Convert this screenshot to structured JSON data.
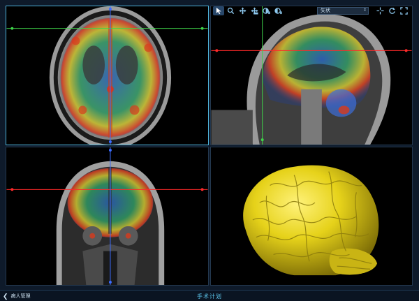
{
  "toolbar": {
    "tools": [
      {
        "id": "pointer",
        "icon": "pointer-icon",
        "active": true
      },
      {
        "id": "zoom",
        "icon": "zoom-icon"
      },
      {
        "id": "pan",
        "icon": "pan-icon"
      },
      {
        "id": "crosshair-move",
        "icon": "move-crosshair-icon"
      },
      {
        "id": "window-level-a",
        "icon": "window-level-icon"
      },
      {
        "id": "window-level-b",
        "icon": "contrast-icon"
      }
    ],
    "view_select": {
      "value": "矢状"
    },
    "right_tools": [
      {
        "id": "crosshair",
        "icon": "crosshair-icon"
      },
      {
        "id": "reset",
        "icon": "reset-icon"
      },
      {
        "id": "fullscreen",
        "icon": "fullscreen-icon"
      }
    ]
  },
  "viewports": {
    "axial": {
      "crosshair_h": "#3fd24a",
      "crosshair_v": "#3c6cff"
    },
    "sagittal": {
      "crosshair_h": "#ff2a2a",
      "crosshair_v": "#3fd24a"
    },
    "coronal": {
      "crosshair_h": "#ff2a2a",
      "crosshair_v": "#3c6cff"
    },
    "render3d": {
      "model_color": "#e6d21a"
    }
  },
  "bottom_bar": {
    "back_label": "病人管理",
    "title": "手术计划"
  },
  "colors": {
    "active_border": "#4fb3d9",
    "accent": "#5cc4ea"
  }
}
